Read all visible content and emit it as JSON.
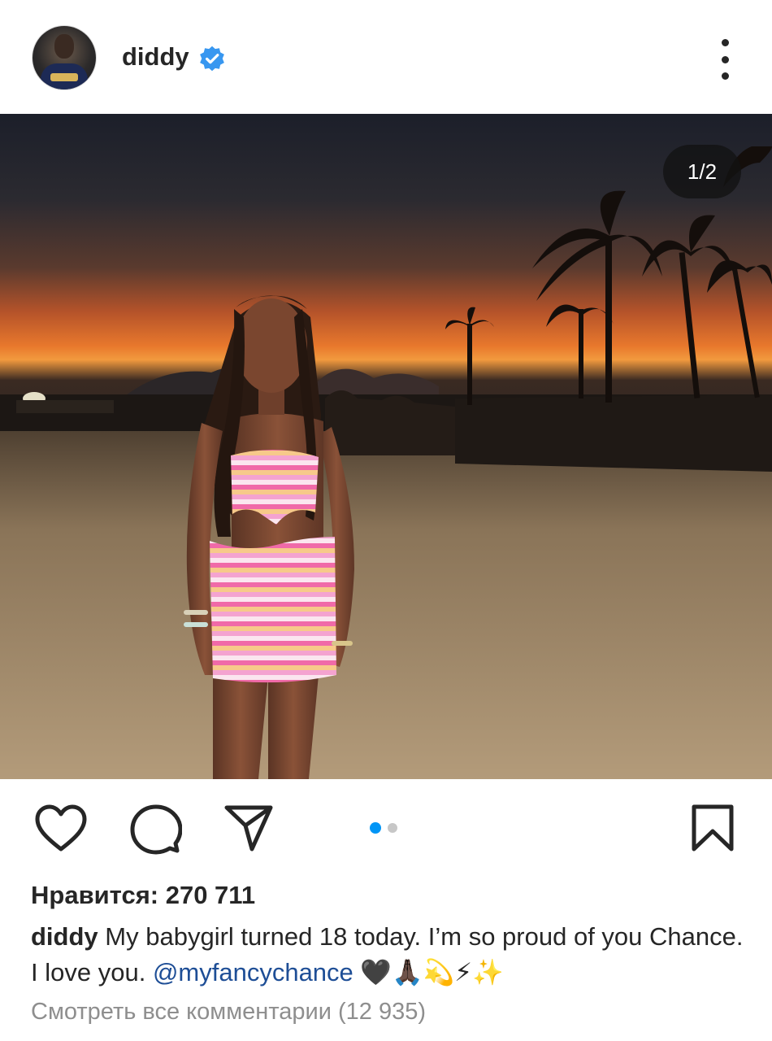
{
  "post": {
    "username": "diddy",
    "verified": true,
    "slide_counter": "1/2",
    "slide_index": 1,
    "slide_total": 2
  },
  "stats": {
    "likes_label": "Нравится: 270 711"
  },
  "caption": {
    "username": "diddy",
    "text": "My babygirl turned 18 today. I’m so proud of you Chance. I love you.",
    "mention": "@myfancychance",
    "emojis": "🖤🙏🏿💫⚡✨"
  },
  "comments": {
    "link_label": "Смотреть все комментарии (12 935)"
  },
  "icons": {
    "more": "more-vertical-icon",
    "like": "heart-icon",
    "comment": "comment-icon",
    "share": "paper-plane-icon",
    "save": "bookmark-icon",
    "verified": "verified-badge-icon"
  },
  "colors": {
    "verified": "#3897f0",
    "dot_active": "#0095f6",
    "dot_inactive": "#c7c7c7",
    "text": "#262626",
    "muted": "#8e8e8e",
    "mention": "#1e4e96"
  }
}
